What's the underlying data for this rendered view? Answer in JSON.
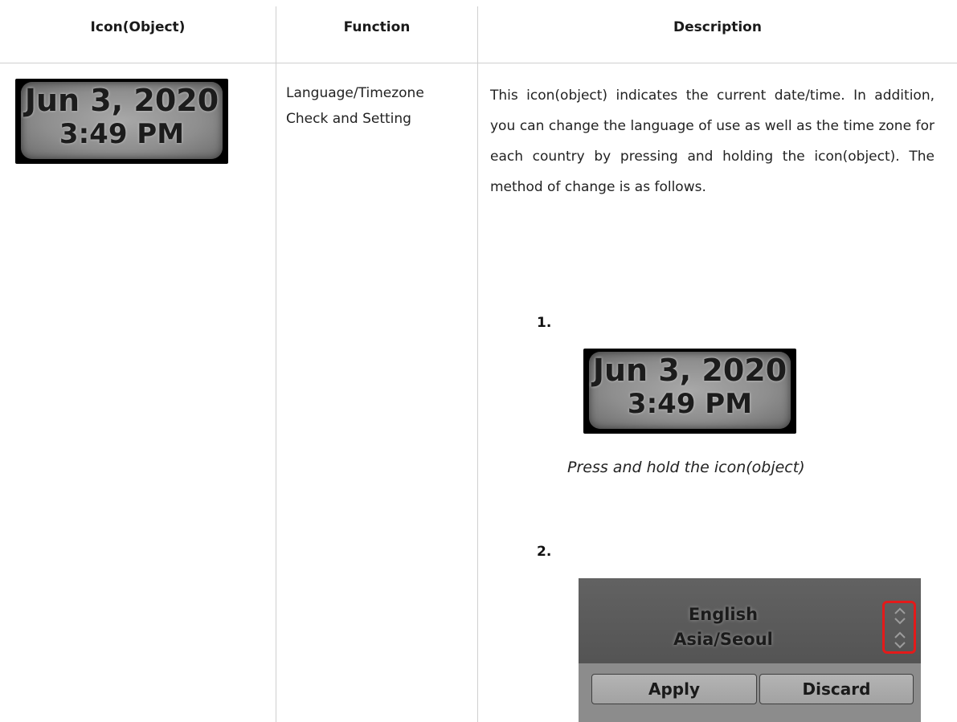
{
  "table": {
    "headers": [
      "Icon(Object)",
      "Function",
      "Description"
    ]
  },
  "row": {
    "clock": {
      "date": "Jun 3, 2020",
      "time": "3:49 PM"
    },
    "function_lines": [
      "Language/Timezone",
      "Check and Setting"
    ],
    "description": "This icon(object) indicates the current date/time. In addition, you can change the language of use as well as the time zone for each country by pressing and holding the icon(object). The method of change is as follows."
  },
  "steps": [
    {
      "number": "1.",
      "clock": {
        "date": "Jun 3, 2020",
        "time": "3:49 PM"
      },
      "caption": "Press and hold the icon(object)"
    },
    {
      "number": "2.",
      "panel": {
        "language": "English",
        "timezone": "Asia/Seoul",
        "apply_label": "Apply",
        "discard_label": "Discard"
      }
    }
  ],
  "colors": {
    "highlight": "#e41a1a",
    "panel_bg": "#595959",
    "button_bg": "#aaaaaa"
  }
}
